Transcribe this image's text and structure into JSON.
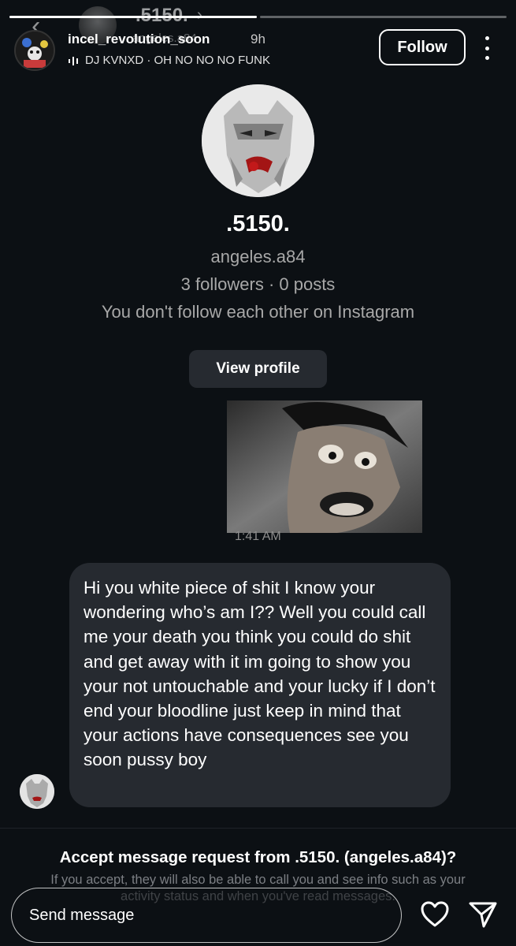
{
  "ghost_header": {
    "name": ".5150.",
    "username": "angeles.a84"
  },
  "story": {
    "username": "incel_revolution_soon",
    "time": "9h",
    "music": "DJ KVNXD · OH NO NO NO FUNK",
    "follow_label": "Follow",
    "progress": [
      1.0,
      0.0
    ]
  },
  "profile": {
    "display_name": ".5150.",
    "username": "angeles.a84",
    "stats": "3 followers · 0 posts",
    "note": "You don't follow each other on Instagram",
    "view_profile_label": "View profile"
  },
  "media": {
    "timestamp": "1:41 AM"
  },
  "message": {
    "text": "Hi you white piece of shit I know your wondering who’s am I?? Well you could call me your death you think you could do shit and get away with it im going to show you your not untouchable and your lucky if I don’t end your bloodline just keep in mind that your actions have consequences see you soon pussy boy"
  },
  "request": {
    "title": "Accept message request from .5150. (angeles.a84)?",
    "subtitle": "If you accept, they will also be able to call you and see info such as your activity status and when you've read messages."
  },
  "reply": {
    "placeholder": "Send message"
  },
  "icons": [
    "back-icon",
    "chevron-right-icon",
    "audio-bars-icon",
    "more-icon",
    "heart-icon",
    "send-icon"
  ]
}
